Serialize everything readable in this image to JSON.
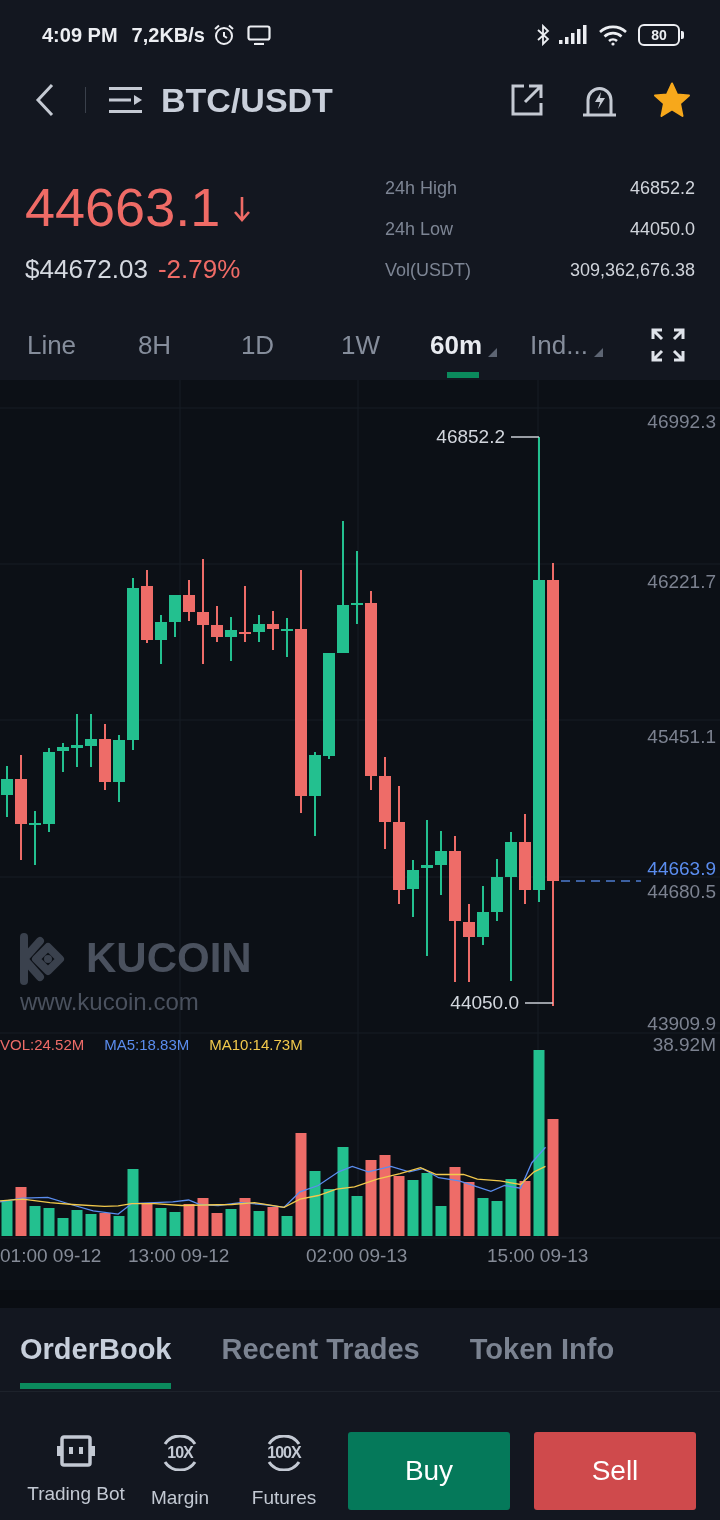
{
  "status_bar": {
    "time": "4:09 PM",
    "speed": "7,2KB/s",
    "battery": "80"
  },
  "header": {
    "title": "BTC/USDT",
    "favorite": true
  },
  "ticker": {
    "price": "44663.1",
    "falling": true,
    "fiat_price": "$44672.03",
    "change": "-2.79%",
    "stats": [
      {
        "label": "24h High",
        "value": "46852.2"
      },
      {
        "label": "24h Low",
        "value": "44050.0"
      },
      {
        "label": "Vol(USDT)",
        "value": "309,362,676.38"
      }
    ]
  },
  "interval_tabs": [
    {
      "label": "Line",
      "selected": false,
      "dropdown": false
    },
    {
      "label": "8H",
      "selected": false,
      "dropdown": false
    },
    {
      "label": "1D",
      "selected": false,
      "dropdown": false
    },
    {
      "label": "1W",
      "selected": false,
      "dropdown": false
    },
    {
      "label": "60m",
      "selected": true,
      "dropdown": true
    },
    {
      "label": "Ind...",
      "selected": false,
      "dropdown": true
    }
  ],
  "chart": {
    "price_axis": [
      "46992.3",
      "46221.7",
      "45451.1",
      "44680.5",
      "43909.9"
    ],
    "high_label": "46852.2",
    "low_label": "44050.0",
    "last_price": "44663.9",
    "logo": {
      "name": "KUCOIN",
      "url": "www.kucoin.com"
    },
    "volume_legend": [
      {
        "label": "VOL:24.52M",
        "color": "#ee6c68"
      },
      {
        "label": "MA5:18.83M",
        "color": "#5b8def"
      },
      {
        "label": "MA10:14.73M",
        "color": "#f2c94c"
      }
    ],
    "volume_max": "38.92M",
    "time_axis": [
      "01:00 09-12",
      "13:00 09-12",
      "02:00 09-13",
      "15:00 09-13"
    ]
  },
  "bottom_tabs": [
    {
      "label": "OrderBook",
      "selected": true
    },
    {
      "label": "Recent Trades",
      "selected": false
    },
    {
      "label": "Token Info",
      "selected": false
    }
  ],
  "actions": [
    {
      "kind": "bot",
      "label": "Trading Bot"
    },
    {
      "kind": "leverage",
      "label": "Margin",
      "badge": "10X"
    },
    {
      "kind": "leverage",
      "label": "Futures",
      "badge": "100X"
    }
  ],
  "trade_buttons": [
    {
      "kind": "buy",
      "label": "Buy"
    },
    {
      "kind": "sell",
      "label": "Sell"
    }
  ]
}
